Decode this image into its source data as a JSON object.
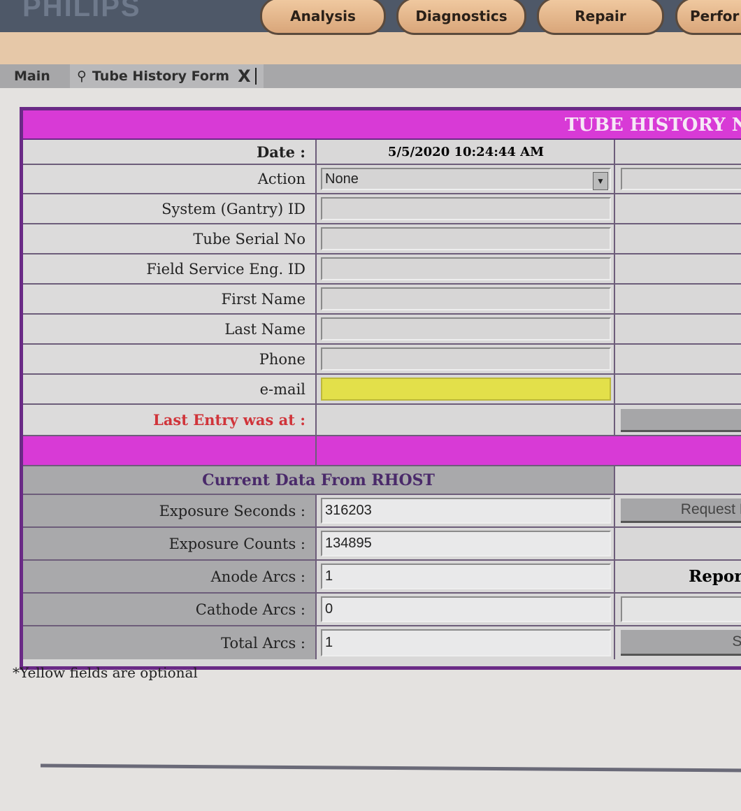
{
  "brand": "PHILIPS",
  "nav_tabs": [
    "Analysis",
    "Diagnostics",
    "Repair",
    "Perfor"
  ],
  "doc_tabs": {
    "main": "Main",
    "active": "Tube History Form",
    "close": "X"
  },
  "form": {
    "title": "TUBE HISTORY N",
    "date_label": "Date :",
    "date_value": "5/5/2020 10:24:44 AM",
    "action_label": "Action",
    "action_value": "None",
    "fields": [
      {
        "label": "System (Gantry) ID",
        "value": ""
      },
      {
        "label": "Tube Serial No",
        "value": ""
      },
      {
        "label": "Field Service Eng. ID",
        "value": ""
      },
      {
        "label": "First Name",
        "value": ""
      },
      {
        "label": "Last Name",
        "value": ""
      },
      {
        "label": "Phone",
        "value": ""
      },
      {
        "label": "e-mail",
        "value": "",
        "optional": true
      }
    ],
    "last_entry_label": "Last Entry was at :",
    "last_entry_value": "",
    "current_header": "Current Data From RHOST",
    "current": [
      {
        "label": "Exposure Seconds :",
        "value": "316203"
      },
      {
        "label": "Exposure Counts :",
        "value": "134895"
      },
      {
        "label": "Anode Arcs :",
        "value": "1"
      },
      {
        "label": "Cathode Arcs :",
        "value": "0"
      },
      {
        "label": "Total Arcs :",
        "value": "1"
      }
    ],
    "request_button": "Request D",
    "report_label": "Report",
    "save_button": "Sa"
  },
  "note": "*Yellow fields are optional",
  "colors": {
    "header": "#d83ad6",
    "border": "#6a2a86",
    "optional": "#e3e04a"
  }
}
